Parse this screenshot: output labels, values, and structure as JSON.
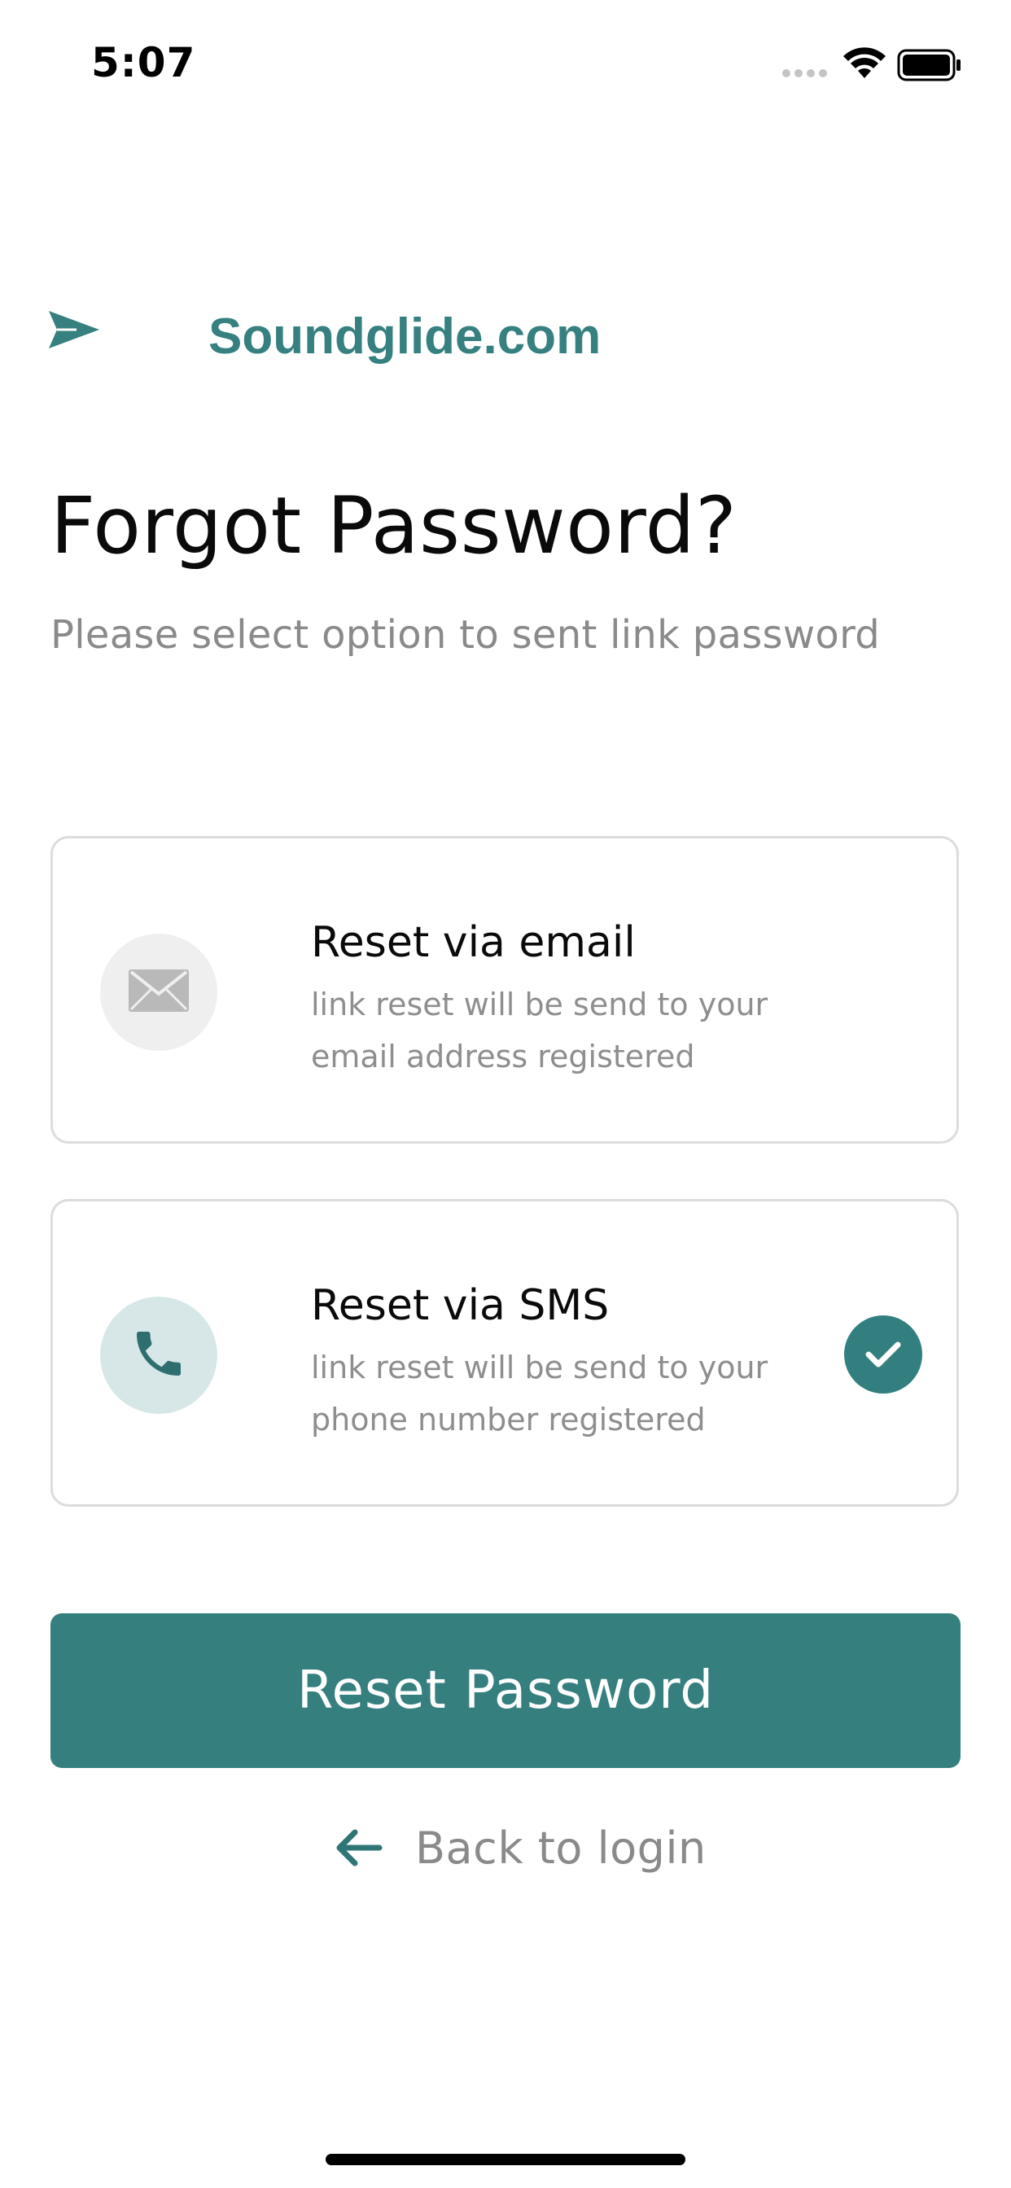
{
  "status_bar": {
    "time": "5:07"
  },
  "brand": {
    "name": "Soundglide.com",
    "icon": "paper-plane-icon",
    "color": "#368080"
  },
  "header": {
    "title": "Forgot Password?",
    "subtitle": "Please select option to sent link password"
  },
  "options": [
    {
      "icon": "envelope-icon",
      "title": "Reset via email",
      "description": "link reset will be send to your email address registered",
      "selected": false
    },
    {
      "icon": "phone-icon",
      "title": "Reset via SMS",
      "description": "link reset will be send to your phone number registered",
      "selected": true
    }
  ],
  "actions": {
    "reset_label": "Reset Password",
    "back_label": "Back to login"
  },
  "colors": {
    "accent": "#367F7F",
    "muted_text": "#8A8A8A",
    "card_border": "#DCDCDC"
  }
}
